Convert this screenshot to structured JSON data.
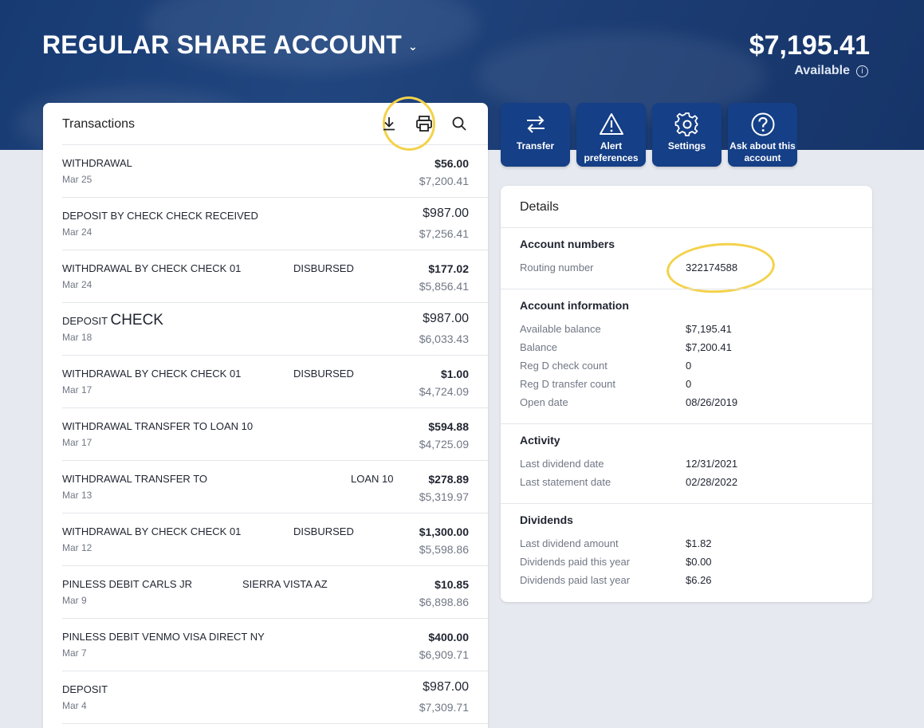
{
  "header": {
    "account_title": "REGULAR SHARE ACCOUNT",
    "balance": "$7,195.41",
    "available_label": "Available"
  },
  "transactions": {
    "title": "Transactions",
    "rows": [
      {
        "desc": "WITHDRAWAL",
        "date": "Mar 25",
        "amount": "$56.00",
        "balance": "$7,200.41",
        "bold": true
      },
      {
        "desc": "DEPOSIT BY CHECK CHECK RECEIVED",
        "date": "Mar 24",
        "amount": "$987.00",
        "balance": "$7,256.41",
        "bold": false
      },
      {
        "desc": "WITHDRAWAL BY CHECK CHECK 01",
        "desc2": "DISBURSED",
        "date": "Mar 24",
        "amount": "$177.02",
        "balance": "$5,856.41",
        "bold": true
      },
      {
        "desc": "DEPOSIT",
        "desc_big": "CHECK",
        "date": "Mar 18",
        "amount": "$987.00",
        "balance": "$6,033.43",
        "bold": false
      },
      {
        "desc": "WITHDRAWAL BY CHECK CHECK 01",
        "desc2": "DISBURSED",
        "date": "Mar 17",
        "amount": "$1.00",
        "balance": "$4,724.09",
        "bold": true
      },
      {
        "desc": "WITHDRAWAL TRANSFER TO LOAN 10",
        "date": "Mar 17",
        "amount": "$594.88",
        "balance": "$4,725.09",
        "bold": true
      },
      {
        "desc": "WITHDRAWAL TRANSFER TO",
        "desc2": "LOAN 10",
        "date": "Mar 13",
        "amount": "$278.89",
        "balance": "$5,319.97",
        "bold": true
      },
      {
        "desc": "WITHDRAWAL BY CHECK CHECK 01",
        "desc2": "DISBURSED",
        "date": "Mar 12",
        "amount": "$1,300.00",
        "balance": "$5,598.86",
        "bold": true
      },
      {
        "desc": "PINLESS DEBIT CARLS JR",
        "desc2": "SIERRA VISTA AZ",
        "date": "Mar 9",
        "amount": "$10.85",
        "balance": "$6,898.86",
        "bold": true
      },
      {
        "desc": "PINLESS DEBIT VENMO VISA DIRECT NY",
        "date": "Mar 7",
        "amount": "$400.00",
        "balance": "$6,909.71",
        "bold": true
      },
      {
        "desc": "DEPOSIT",
        "date": "Mar 4",
        "amount": "$987.00",
        "balance": "$7,309.71",
        "bold": false
      }
    ]
  },
  "actions": [
    {
      "label": "Transfer",
      "icon": "transfer-icon"
    },
    {
      "label": "Alert preferences",
      "icon": "alert-icon"
    },
    {
      "label": "Settings",
      "icon": "gear-icon"
    },
    {
      "label": "Ask about this account",
      "icon": "question-icon"
    }
  ],
  "details": {
    "title": "Details",
    "account_numbers": {
      "title": "Account numbers",
      "routing_label": "Routing number",
      "routing_value": "322174588"
    },
    "account_information": {
      "title": "Account information",
      "items": [
        {
          "label": "Available balance",
          "value": "$7,195.41"
        },
        {
          "label": "Balance",
          "value": "$7,200.41"
        },
        {
          "label": "Reg D check count",
          "value": "0"
        },
        {
          "label": "Reg D transfer count",
          "value": "0"
        },
        {
          "label": "Open date",
          "value": "08/26/2019"
        }
      ]
    },
    "activity": {
      "title": "Activity",
      "items": [
        {
          "label": "Last dividend date",
          "value": "12/31/2021"
        },
        {
          "label": "Last statement date",
          "value": "02/28/2022"
        }
      ]
    },
    "dividends": {
      "title": "Dividends",
      "items": [
        {
          "label": "Last dividend amount",
          "value": "$1.82"
        },
        {
          "label": "Dividends paid this year",
          "value": "$0.00"
        },
        {
          "label": "Dividends paid last year",
          "value": "$6.26"
        }
      ]
    }
  },
  "colors": {
    "hero": "#1c3d74",
    "action_button": "#153f86",
    "highlight": "#f3d24a"
  }
}
